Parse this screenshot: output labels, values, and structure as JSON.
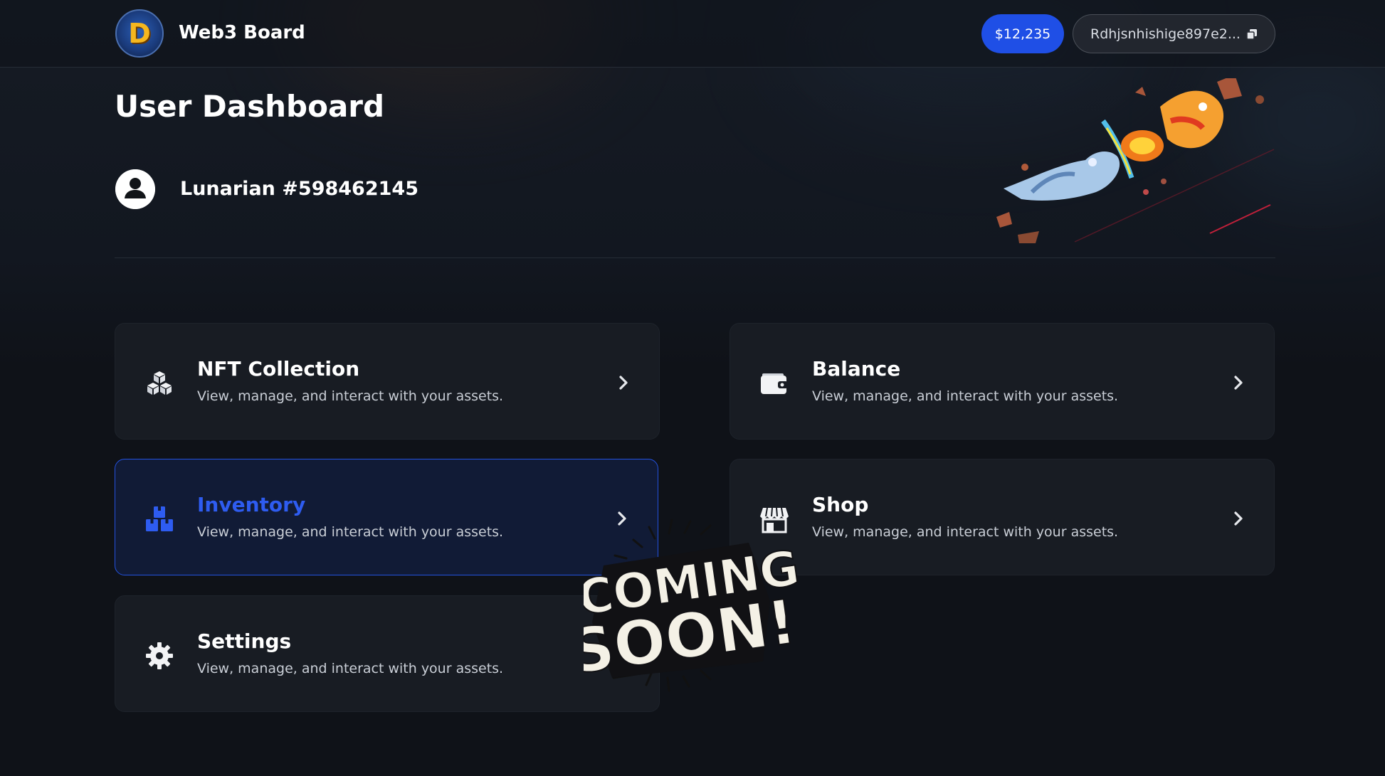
{
  "header": {
    "brand_name": "Web3 Board",
    "logo_letter": "D",
    "balance": "$12,235",
    "wallet_address": "Rdhjsnhishige897e2..."
  },
  "profile": {
    "page_title": "User Dashboard",
    "username": "Lunarian #598462145"
  },
  "cards": [
    {
      "title": "NFT Collection",
      "description": "View, manage, and interact with your assets.",
      "icon": "cubes-icon"
    },
    {
      "title": "Balance",
      "description": "View, manage, and interact with your assets.",
      "icon": "wallet-icon"
    },
    {
      "title": "Inventory",
      "description": "View, manage, and interact with your assets.",
      "icon": "boxes-icon",
      "active": true
    },
    {
      "title": "Shop",
      "description": "View, manage, and interact with your assets.",
      "icon": "store-icon"
    },
    {
      "title": "Settings",
      "description": "View, manage, and interact with your assets.",
      "icon": "gear-icon"
    }
  ],
  "overlay": {
    "sticker_line1": "COMING",
    "sticker_line2": "SOON!"
  },
  "colors": {
    "accent": "#1f4fe6",
    "active_title": "#2e5cf0",
    "card_bg": "#181c23",
    "page_bg": "#0f1218"
  }
}
